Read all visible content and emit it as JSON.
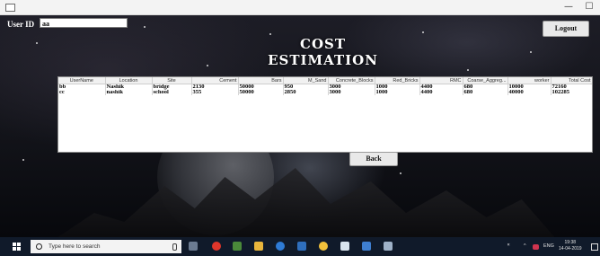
{
  "window": {
    "minimize": "—",
    "maximize": "☐"
  },
  "user": {
    "label": "User ID",
    "value": "aa"
  },
  "logout_label": "Logout",
  "title": "COST ESTIMATION",
  "table": {
    "columns": [
      "UserName",
      "Location",
      "Site",
      "Cement",
      "Bars",
      "M_Sand",
      "Concrete_Blocks",
      "Red_Bricks",
      "RMC",
      "Coarse_Aggreg...",
      "worker",
      "Total Cost"
    ],
    "rows": [
      [
        "bb",
        "Nashik",
        "bridge",
        "2130",
        "50000",
        "950",
        "3000",
        "1000",
        "4400",
        "680",
        "10000",
        "72160"
      ],
      [
        "cc",
        "nashik",
        "school",
        "355",
        "50000",
        "2850",
        "3000",
        "1000",
        "4400",
        "680",
        "40000",
        "102285"
      ]
    ]
  },
  "back_label": "Back",
  "taskbar": {
    "search_placeholder": "Type here to search",
    "language": "ENG",
    "time": "19:38",
    "date": "14-04-2019"
  }
}
